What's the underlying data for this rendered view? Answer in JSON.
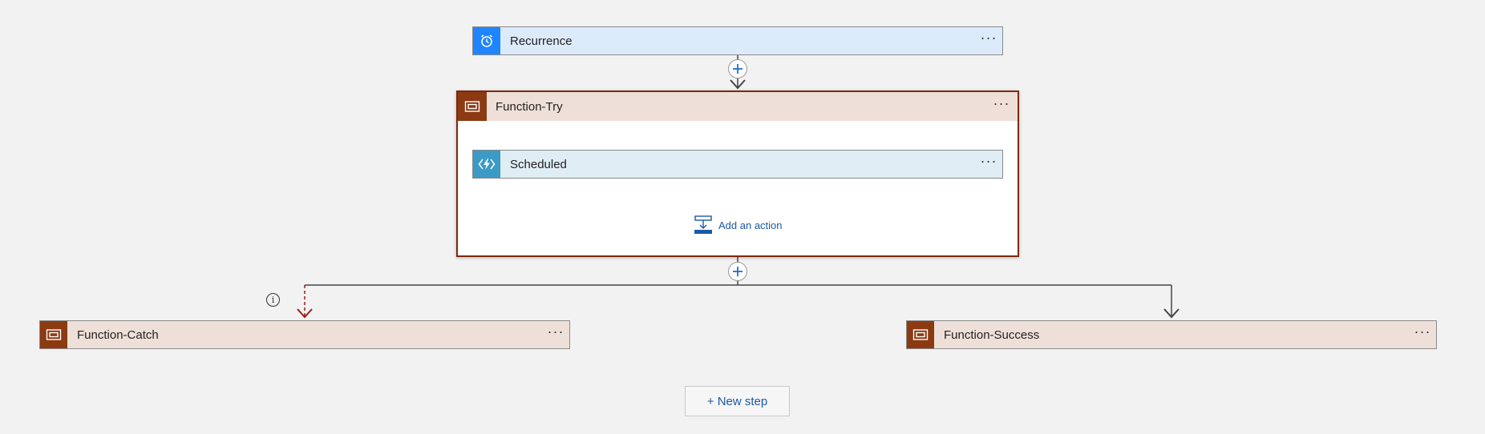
{
  "flow": {
    "recurrence": {
      "title": "Recurrence",
      "more": "···"
    },
    "function_try": {
      "title": "Function-Try",
      "more": "···",
      "inner_action": {
        "title": "Scheduled",
        "more": "···"
      },
      "add_action_label": "Add an action"
    },
    "function_catch": {
      "title": "Function-Catch",
      "more": "···"
    },
    "function_success": {
      "title": "Function-Success",
      "more": "···"
    },
    "new_step_label": "+ New step",
    "info_glyph": "i"
  },
  "colors": {
    "canvas": "#f2f2f2",
    "recurrence_accent": "#1f85ff",
    "recurrence_bg": "#dcebfc",
    "scope_accent": "#8b3a12",
    "scope_bg": "#eee0d9",
    "azure_function_accent": "#3b9ac6",
    "azure_function_bg": "#dfedf4",
    "link_blue": "#1a5aa6",
    "failure_red": "#9b1c1c"
  },
  "icons": {
    "recurrence": "alarm-clock-icon",
    "scope": "scope-icon",
    "azure_function": "azure-function-icon",
    "add_action": "add-action-icon",
    "insert_step": "plus-icon",
    "more": "ellipsis-icon",
    "info": "info-icon"
  }
}
